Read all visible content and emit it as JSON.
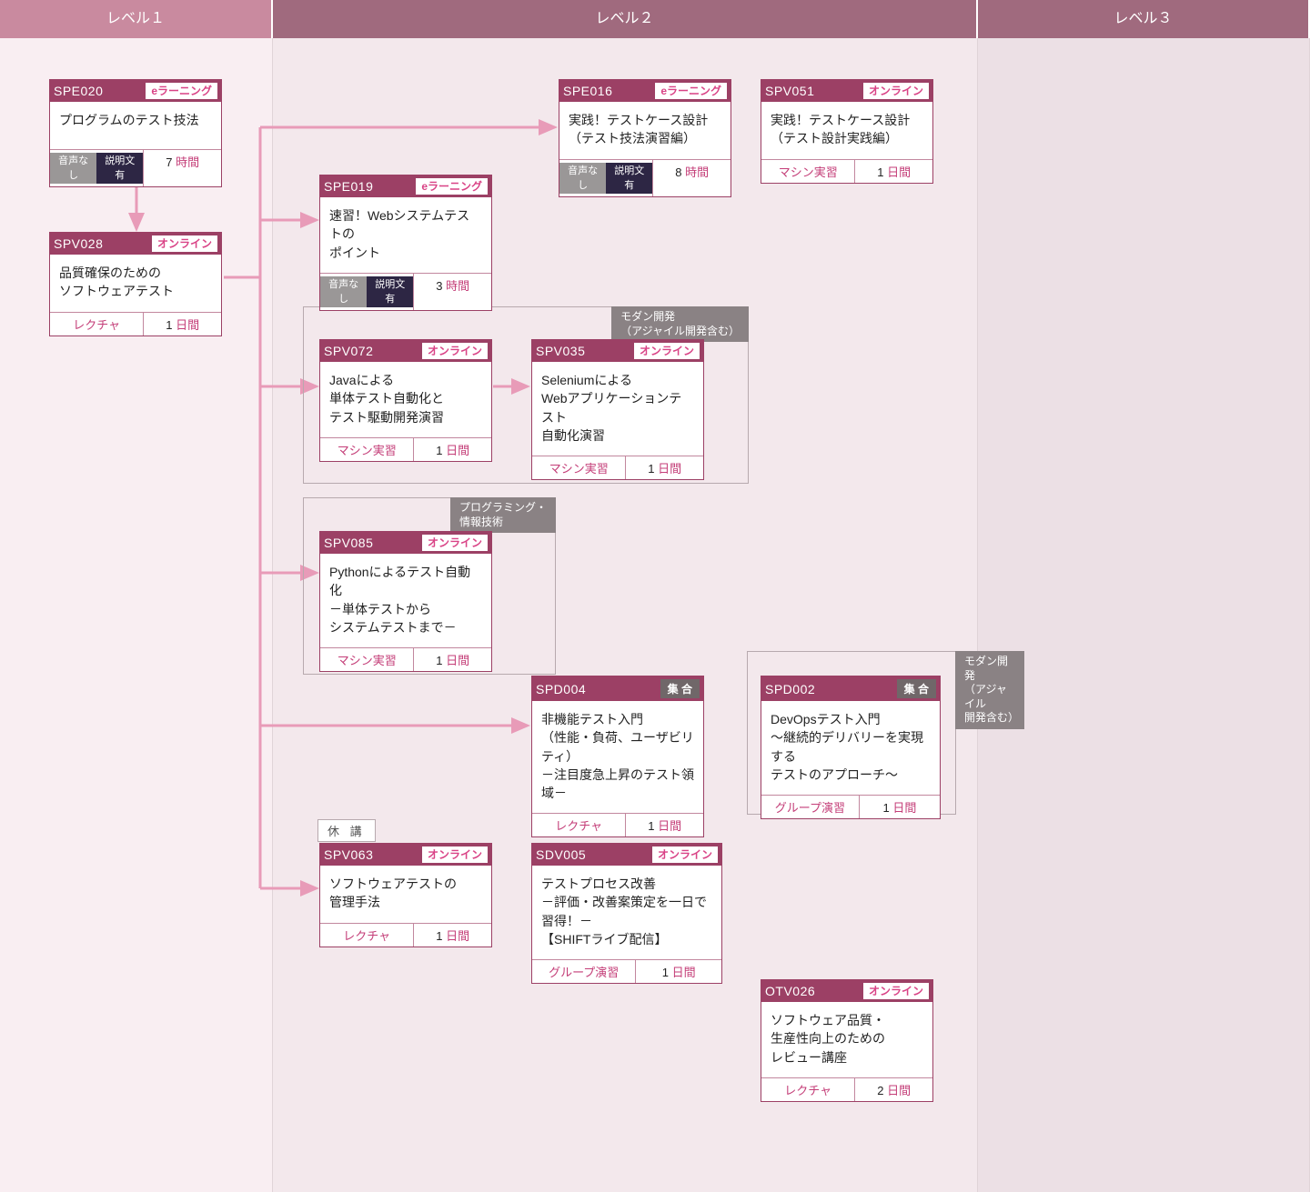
{
  "levels": {
    "l1": "レベル１",
    "l2": "レベル２",
    "l3": "レベル３"
  },
  "badges": {
    "elearning": "eラーニング",
    "online": "オンライン",
    "group": "集 合"
  },
  "mini": {
    "audio_off": "音声なし",
    "desc": "説明文有"
  },
  "units": {
    "hour": "時間",
    "day": "日間"
  },
  "methods": {
    "lecture": "レクチャ",
    "machine": "マシン実習",
    "groupex": "グループ演習"
  },
  "group_labels": {
    "modern": "モダン開発\n（アジャイル開発含む）",
    "prog": "プログラミング・\n情報技術",
    "modern2": "モダン開発\n（アジャイル\n開発含む）"
  },
  "suspend": "休 講",
  "cards": {
    "SPE020": {
      "code": "SPE020",
      "type": "elearning",
      "title": "プログラムのテスト技法",
      "method": "audio",
      "dur": "7",
      "unit": "hour"
    },
    "SPV028": {
      "code": "SPV028",
      "type": "online",
      "title": "品質確保のための\nソフトウェアテスト",
      "method": "lecture",
      "dur": "1",
      "unit": "day"
    },
    "SPE016": {
      "code": "SPE016",
      "type": "elearning",
      "title": "実践！テストケース設計\n（テスト技法演習編）",
      "method": "audio",
      "dur": "8",
      "unit": "hour"
    },
    "SPV051": {
      "code": "SPV051",
      "type": "online",
      "title": "実践！テストケース設計\n（テスト設計実践編）",
      "method": "machine",
      "dur": "1",
      "unit": "day"
    },
    "SPE019": {
      "code": "SPE019",
      "type": "elearning",
      "title": "速習！Webシステムテストの\nポイント",
      "method": "audio",
      "dur": "3",
      "unit": "hour"
    },
    "SPV072": {
      "code": "SPV072",
      "type": "online",
      "title": "Javaによる\n単体テスト自動化と\nテスト駆動開発演習",
      "method": "machine",
      "dur": "1",
      "unit": "day"
    },
    "SPV035": {
      "code": "SPV035",
      "type": "online",
      "title": "Seleniumによる\nWebアプリケーションテスト\n自動化演習",
      "method": "machine",
      "dur": "1",
      "unit": "day"
    },
    "SPV085": {
      "code": "SPV085",
      "type": "online",
      "title": "Pythonによるテスト自動化\n－単体テストから\nシステムテストまで－",
      "method": "machine",
      "dur": "1",
      "unit": "day"
    },
    "SPD004": {
      "code": "SPD004",
      "type": "group",
      "title": "非機能テスト入門\n（性能・負荷、ユーザビリティ）\n－注目度急上昇のテスト領域－",
      "method": "lecture",
      "dur": "1",
      "unit": "day"
    },
    "SPD002": {
      "code": "SPD002",
      "type": "group",
      "title": "DevOpsテスト入門\n～継続的デリバリーを実現する\nテストのアプローチ～",
      "method": "groupex",
      "dur": "1",
      "unit": "day"
    },
    "SPV063": {
      "code": "SPV063",
      "type": "online",
      "title": "ソフトウェアテストの\n管理手法",
      "method": "lecture",
      "dur": "1",
      "unit": "day"
    },
    "SDV005": {
      "code": "SDV005",
      "type": "online",
      "title": "テストプロセス改善\n－評価・改善案策定を一日で習得！－\n【SHIFTライブ配信】",
      "method": "groupex",
      "dur": "1",
      "unit": "day"
    },
    "OTV026": {
      "code": "OTV026",
      "type": "online",
      "title": "ソフトウェア品質・\n生産性向上のための\nレビュー講座",
      "method": "lecture",
      "dur": "2",
      "unit": "day"
    }
  }
}
